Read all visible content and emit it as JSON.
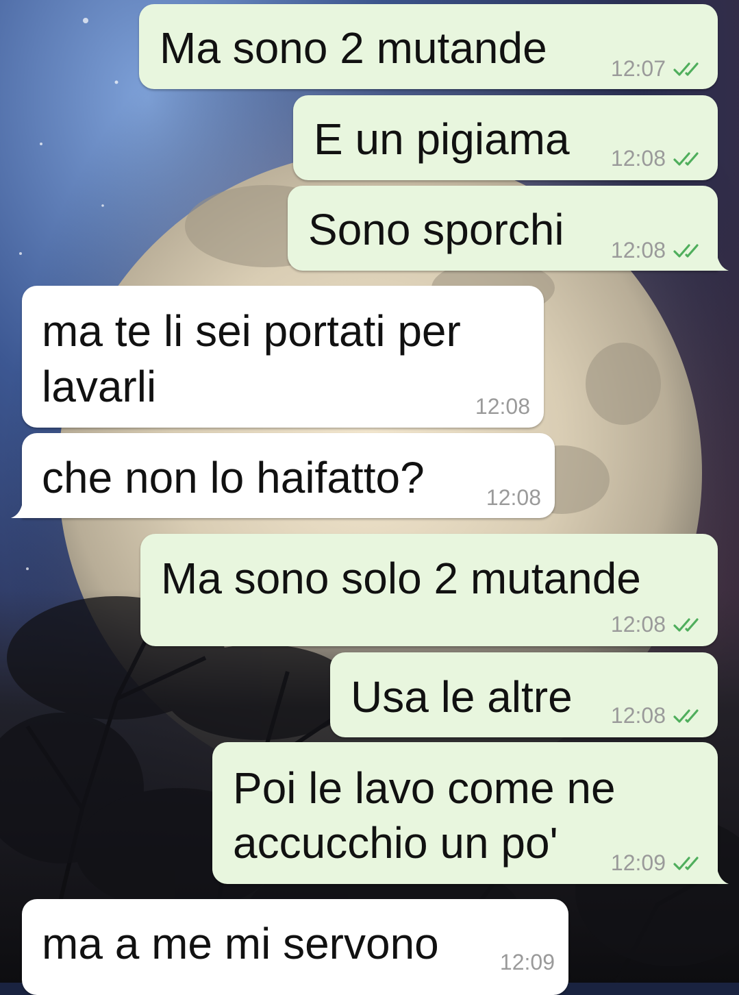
{
  "messages": [
    {
      "direction": "out",
      "text": [
        "Ma sono 2 mutande"
      ],
      "time": "12:07",
      "status": "read-double-check"
    },
    {
      "direction": "out",
      "text": [
        "E un pigiama"
      ],
      "time": "12:08",
      "status": "read-double-check"
    },
    {
      "direction": "out",
      "text": [
        "Sono sporchi"
      ],
      "time": "12:08",
      "status": "read-double-check"
    },
    {
      "direction": "in",
      "text": [
        "ma te li sei portati per",
        "lavarli"
      ],
      "time": "12:08"
    },
    {
      "direction": "in",
      "text": [
        "che non lo haifatto?"
      ],
      "time": "12:08"
    },
    {
      "direction": "out",
      "text": [
        "Ma sono solo 2 mutande"
      ],
      "time": "12:08",
      "status": "read-double-check"
    },
    {
      "direction": "out",
      "text": [
        "Usa le altre"
      ],
      "time": "12:08",
      "status": "read-double-check"
    },
    {
      "direction": "out",
      "text": [
        "Poi le lavo come ne",
        "accucchio un po'"
      ],
      "time": "12:09",
      "status": "read-double-check"
    },
    {
      "direction": "in",
      "text": [
        "ma a me mi servono"
      ],
      "time": "12:09"
    }
  ],
  "colors": {
    "outgoing_bubble": "#e8f6de",
    "incoming_bubble": "#ffffff",
    "read_ticks": "#4fae5c",
    "timestamp": "#9a9a9a"
  },
  "icons": {
    "status": "double-check-icon",
    "wallpaper": "full-moon-night-sky"
  }
}
